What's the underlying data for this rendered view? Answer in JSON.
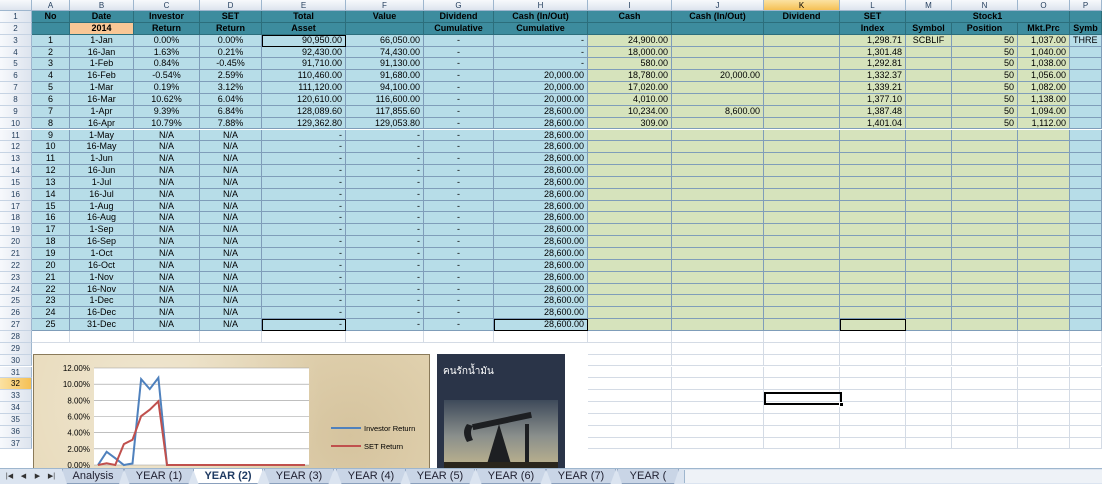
{
  "columns": [
    "A",
    "B",
    "C",
    "D",
    "E",
    "F",
    "G",
    "H",
    "I",
    "J",
    "K",
    "L",
    "M",
    "N",
    "O",
    "P"
  ],
  "selected_column": "K",
  "rows": [
    "1",
    "2",
    "3",
    "4",
    "5",
    "6",
    "7",
    "8",
    "9",
    "10",
    "11",
    "12",
    "13",
    "14",
    "15",
    "16",
    "17",
    "18",
    "19",
    "20",
    "21",
    "22",
    "23",
    "24",
    "25",
    "26",
    "27",
    "28",
    "29",
    "30",
    "31",
    "32",
    "33",
    "34",
    "35",
    "36",
    "37"
  ],
  "selected_row": "32",
  "header1": {
    "no": "No",
    "date": "Date",
    "investor": "Investor",
    "set": "SET",
    "total": "Total",
    "value": "Value",
    "dividend": "Dividend",
    "cash_inout": "Cash (In/Out)",
    "cash": "Cash",
    "cash_inout2": "Cash (In/Out)",
    "dividend2": "Dividend",
    "set2": "SET",
    "stock1": "Stock1"
  },
  "header2": {
    "year": "2014",
    "return1": "Return",
    "return2": "Return",
    "asset": "Asset",
    "cumulative1": "Cumulative",
    "cumulative2": "Cumulative",
    "index": "Index",
    "symbol": "Symbol",
    "position": "Position",
    "mktprc": "Mkt.Prc",
    "symb": "Symb"
  },
  "data_rows": [
    [
      "1",
      "1-Jan",
      "0.00%",
      "0.00%",
      "90,950.00",
      "66,050.00",
      "-",
      "-",
      "24,900.00",
      "",
      "",
      "1,298.71",
      "SCBLIF",
      "50",
      "1,037.00",
      "THRE"
    ],
    [
      "2",
      "16-Jan",
      "1.63%",
      "0.21%",
      "92,430.00",
      "74,430.00",
      "-",
      "-",
      "18,000.00",
      "",
      "",
      "1,301.48",
      "",
      "50",
      "1,040.00",
      ""
    ],
    [
      "3",
      "1-Feb",
      "0.84%",
      "-0.45%",
      "91,710.00",
      "91,130.00",
      "-",
      "-",
      "580.00",
      "",
      "",
      "1,292.81",
      "",
      "50",
      "1,038.00",
      ""
    ],
    [
      "4",
      "16-Feb",
      "-0.54%",
      "2.59%",
      "110,460.00",
      "91,680.00",
      "-",
      "20,000.00",
      "18,780.00",
      "20,000.00",
      "",
      "1,332.37",
      "",
      "50",
      "1,056.00",
      ""
    ],
    [
      "5",
      "1-Mar",
      "0.19%",
      "3.12%",
      "111,120.00",
      "94,100.00",
      "-",
      "20,000.00",
      "17,020.00",
      "",
      "",
      "1,339.21",
      "",
      "50",
      "1,082.00",
      ""
    ],
    [
      "6",
      "16-Mar",
      "10.62%",
      "6.04%",
      "120,610.00",
      "116,600.00",
      "-",
      "20,000.00",
      "4,010.00",
      "",
      "",
      "1,377.10",
      "",
      "50",
      "1,138.00",
      ""
    ],
    [
      "7",
      "1-Apr",
      "9.39%",
      "6.84%",
      "128,089.60",
      "117,855.60",
      "-",
      "28,600.00",
      "10,234.00",
      "8,600.00",
      "",
      "1,387.48",
      "",
      "50",
      "1,094.00",
      ""
    ],
    [
      "8",
      "16-Apr",
      "10.79%",
      "7.88%",
      "129,362.80",
      "129,053.80",
      "-",
      "28,600.00",
      "309.00",
      "",
      "",
      "1,401.04",
      "",
      "50",
      "1,112.00",
      ""
    ],
    [
      "9",
      "1-May",
      "N/A",
      "N/A",
      "-",
      "-",
      "-",
      "28,600.00",
      "",
      "",
      "",
      "",
      "",
      "",
      "",
      ""
    ],
    [
      "10",
      "16-May",
      "N/A",
      "N/A",
      "-",
      "-",
      "-",
      "28,600.00",
      "",
      "",
      "",
      "",
      "",
      "",
      "",
      ""
    ],
    [
      "11",
      "1-Jun",
      "N/A",
      "N/A",
      "-",
      "-",
      "-",
      "28,600.00",
      "",
      "",
      "",
      "",
      "",
      "",
      "",
      ""
    ],
    [
      "12",
      "16-Jun",
      "N/A",
      "N/A",
      "-",
      "-",
      "-",
      "28,600.00",
      "",
      "",
      "",
      "",
      "",
      "",
      "",
      ""
    ],
    [
      "13",
      "1-Jul",
      "N/A",
      "N/A",
      "-",
      "-",
      "-",
      "28,600.00",
      "",
      "",
      "",
      "",
      "",
      "",
      "",
      ""
    ],
    [
      "14",
      "16-Jul",
      "N/A",
      "N/A",
      "-",
      "-",
      "-",
      "28,600.00",
      "",
      "",
      "",
      "",
      "",
      "",
      "",
      ""
    ],
    [
      "15",
      "1-Aug",
      "N/A",
      "N/A",
      "-",
      "-",
      "-",
      "28,600.00",
      "",
      "",
      "",
      "",
      "",
      "",
      "",
      ""
    ],
    [
      "16",
      "16-Aug",
      "N/A",
      "N/A",
      "-",
      "-",
      "-",
      "28,600.00",
      "",
      "",
      "",
      "",
      "",
      "",
      "",
      ""
    ],
    [
      "17",
      "1-Sep",
      "N/A",
      "N/A",
      "-",
      "-",
      "-",
      "28,600.00",
      "",
      "",
      "",
      "",
      "",
      "",
      "",
      ""
    ],
    [
      "18",
      "16-Sep",
      "N/A",
      "N/A",
      "-",
      "-",
      "-",
      "28,600.00",
      "",
      "",
      "",
      "",
      "",
      "",
      "",
      ""
    ],
    [
      "19",
      "1-Oct",
      "N/A",
      "N/A",
      "-",
      "-",
      "-",
      "28,600.00",
      "",
      "",
      "",
      "",
      "",
      "",
      "",
      ""
    ],
    [
      "20",
      "16-Oct",
      "N/A",
      "N/A",
      "-",
      "-",
      "-",
      "28,600.00",
      "",
      "",
      "",
      "",
      "",
      "",
      "",
      ""
    ],
    [
      "21",
      "1-Nov",
      "N/A",
      "N/A",
      "-",
      "-",
      "-",
      "28,600.00",
      "",
      "",
      "",
      "",
      "",
      "",
      "",
      ""
    ],
    [
      "22",
      "16-Nov",
      "N/A",
      "N/A",
      "-",
      "-",
      "-",
      "28,600.00",
      "",
      "",
      "",
      "",
      "",
      "",
      "",
      ""
    ],
    [
      "23",
      "1-Dec",
      "N/A",
      "N/A",
      "-",
      "-",
      "-",
      "28,600.00",
      "",
      "",
      "",
      "",
      "",
      "",
      "",
      ""
    ],
    [
      "24",
      "16-Dec",
      "N/A",
      "N/A",
      "-",
      "-",
      "-",
      "28,600.00",
      "",
      "",
      "",
      "",
      "",
      "",
      "",
      ""
    ],
    [
      "25",
      "31-Dec",
      "N/A",
      "N/A",
      "-",
      "-",
      "-",
      "28,600.00",
      "",
      "",
      "",
      "",
      "",
      "",
      "",
      ""
    ]
  ],
  "chart": {
    "y_ticks": [
      "12.00%",
      "10.00%",
      "8.00%",
      "6.00%",
      "4.00%",
      "2.00%",
      "0.00%"
    ],
    "legend": [
      "Investor Return",
      "SET Return"
    ],
    "colors": {
      "investor": "#4f81bd",
      "set": "#c0504d"
    }
  },
  "chart_data": {
    "type": "line",
    "x": [
      1,
      2,
      3,
      4,
      5,
      6,
      7,
      8,
      9,
      10,
      11,
      12,
      13,
      14,
      15,
      16,
      17,
      18,
      19,
      20,
      21,
      22,
      23,
      24,
      25
    ],
    "series": [
      {
        "name": "Investor Return",
        "values": [
          0.0,
          1.63,
          0.84,
          -0.54,
          0.19,
          10.62,
          9.39,
          10.79,
          0,
          0,
          0,
          0,
          0,
          0,
          0,
          0,
          0,
          0,
          0,
          0,
          0,
          0,
          0,
          0,
          0
        ]
      },
      {
        "name": "SET Return",
        "values": [
          0.0,
          0.21,
          -0.45,
          2.59,
          3.12,
          6.04,
          6.84,
          7.88,
          0,
          0,
          0,
          0,
          0,
          0,
          0,
          0,
          0,
          0,
          0,
          0,
          0,
          0,
          0,
          0,
          0
        ]
      }
    ],
    "ylim": [
      0,
      12
    ],
    "y_tick_labels": [
      "12.00%",
      "10.00%",
      "8.00%",
      "6.00%",
      "4.00%",
      "2.00%",
      "0.00%"
    ],
    "legend_position": "right"
  },
  "image_panel": {
    "title": "คนรักน้ำมัน"
  },
  "tabs": [
    "Analysis",
    "YEAR (1)",
    "YEAR (2)",
    "YEAR (3)",
    "YEAR (4)",
    "YEAR (5)",
    "YEAR (6)",
    "YEAR (7)",
    "YEAR ("
  ],
  "active_tab": "YEAR (2)"
}
